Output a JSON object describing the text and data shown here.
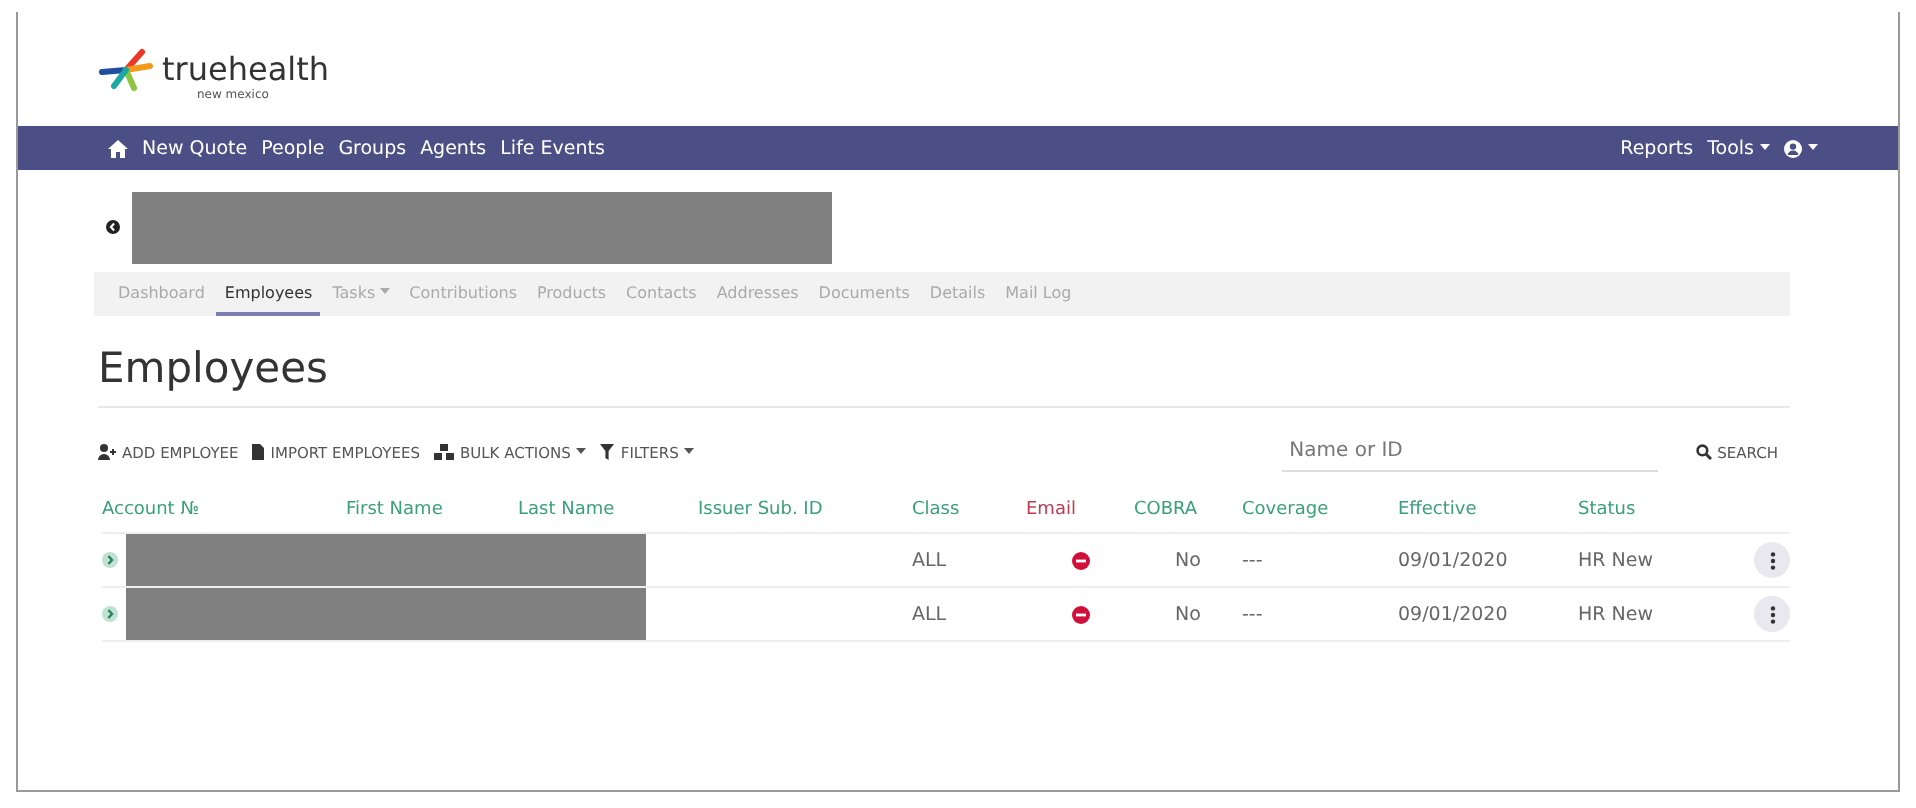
{
  "logo": {
    "name": "truehealth",
    "tagline": "new mexico"
  },
  "navbar": {
    "left": [
      {
        "label": "New Quote"
      },
      {
        "label": "People"
      },
      {
        "label": "Groups"
      },
      {
        "label": "Agents"
      },
      {
        "label": "Life Events"
      }
    ],
    "right": [
      {
        "label": "Reports",
        "dropdown": false
      },
      {
        "label": "Tools",
        "dropdown": true
      }
    ]
  },
  "tabs": [
    {
      "label": "Dashboard",
      "selected": false,
      "dropdown": false
    },
    {
      "label": "Employees",
      "selected": true,
      "dropdown": false
    },
    {
      "label": "Tasks",
      "selected": false,
      "dropdown": true
    },
    {
      "label": "Contributions",
      "selected": false,
      "dropdown": false
    },
    {
      "label": "Products",
      "selected": false,
      "dropdown": false
    },
    {
      "label": "Contacts",
      "selected": false,
      "dropdown": false
    },
    {
      "label": "Addresses",
      "selected": false,
      "dropdown": false
    },
    {
      "label": "Documents",
      "selected": false,
      "dropdown": false
    },
    {
      "label": "Details",
      "selected": false,
      "dropdown": false
    },
    {
      "label": "Mail Log",
      "selected": false,
      "dropdown": false
    }
  ],
  "heading": "Employees",
  "toolbar": [
    {
      "label": "ADD EMPLOYEE",
      "kind": "add",
      "dropdown": false
    },
    {
      "label": "IMPORT EMPLOYEES",
      "kind": "import",
      "dropdown": false
    },
    {
      "label": "BULK ACTIONS",
      "kind": "bulk",
      "dropdown": true
    },
    {
      "label": "FILTERS",
      "kind": "filter",
      "dropdown": true
    }
  ],
  "search": {
    "placeholder": "Name or ID",
    "button": "SEARCH"
  },
  "table": {
    "columns": [
      {
        "label": "Account №",
        "kind": "normal"
      },
      {
        "label": "First Name",
        "kind": "normal"
      },
      {
        "label": "Last Name",
        "kind": "normal"
      },
      {
        "label": "Issuer Sub. ID",
        "kind": "normal"
      },
      {
        "label": "Class",
        "kind": "normal"
      },
      {
        "label": "Email",
        "kind": "alert"
      },
      {
        "label": "COBRA",
        "kind": "normal"
      },
      {
        "label": "Coverage",
        "kind": "normal"
      },
      {
        "label": "Effective",
        "kind": "normal"
      },
      {
        "label": "Status",
        "kind": "normal"
      }
    ],
    "rows": [
      {
        "class": "ALL",
        "email_ok": false,
        "cobra": "No",
        "coverage": "---",
        "effective": "09/01/2020",
        "status": "HR New"
      },
      {
        "class": "ALL",
        "email_ok": false,
        "cobra": "No",
        "coverage": "---",
        "effective": "09/01/2020",
        "status": "HR New"
      }
    ]
  }
}
